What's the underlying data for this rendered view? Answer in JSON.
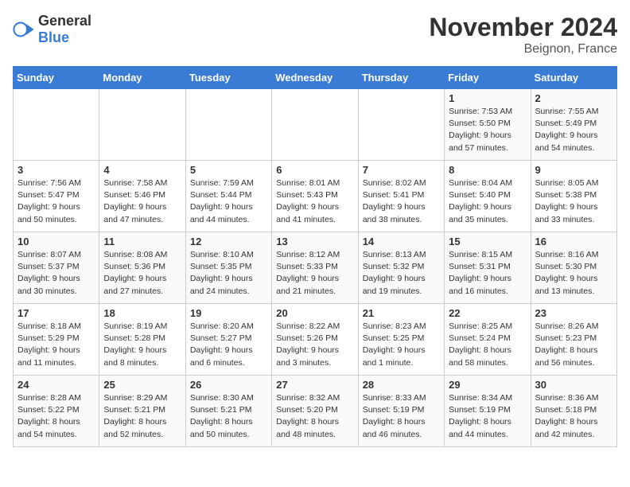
{
  "logo": {
    "text_general": "General",
    "text_blue": "Blue"
  },
  "title": "November 2024",
  "location": "Beignon, France",
  "days_of_week": [
    "Sunday",
    "Monday",
    "Tuesday",
    "Wednesday",
    "Thursday",
    "Friday",
    "Saturday"
  ],
  "weeks": [
    [
      {
        "day": "",
        "info": ""
      },
      {
        "day": "",
        "info": ""
      },
      {
        "day": "",
        "info": ""
      },
      {
        "day": "",
        "info": ""
      },
      {
        "day": "",
        "info": ""
      },
      {
        "day": "1",
        "info": "Sunrise: 7:53 AM\nSunset: 5:50 PM\nDaylight: 9 hours and 57 minutes."
      },
      {
        "day": "2",
        "info": "Sunrise: 7:55 AM\nSunset: 5:49 PM\nDaylight: 9 hours and 54 minutes."
      }
    ],
    [
      {
        "day": "3",
        "info": "Sunrise: 7:56 AM\nSunset: 5:47 PM\nDaylight: 9 hours and 50 minutes."
      },
      {
        "day": "4",
        "info": "Sunrise: 7:58 AM\nSunset: 5:46 PM\nDaylight: 9 hours and 47 minutes."
      },
      {
        "day": "5",
        "info": "Sunrise: 7:59 AM\nSunset: 5:44 PM\nDaylight: 9 hours and 44 minutes."
      },
      {
        "day": "6",
        "info": "Sunrise: 8:01 AM\nSunset: 5:43 PM\nDaylight: 9 hours and 41 minutes."
      },
      {
        "day": "7",
        "info": "Sunrise: 8:02 AM\nSunset: 5:41 PM\nDaylight: 9 hours and 38 minutes."
      },
      {
        "day": "8",
        "info": "Sunrise: 8:04 AM\nSunset: 5:40 PM\nDaylight: 9 hours and 35 minutes."
      },
      {
        "day": "9",
        "info": "Sunrise: 8:05 AM\nSunset: 5:38 PM\nDaylight: 9 hours and 33 minutes."
      }
    ],
    [
      {
        "day": "10",
        "info": "Sunrise: 8:07 AM\nSunset: 5:37 PM\nDaylight: 9 hours and 30 minutes."
      },
      {
        "day": "11",
        "info": "Sunrise: 8:08 AM\nSunset: 5:36 PM\nDaylight: 9 hours and 27 minutes."
      },
      {
        "day": "12",
        "info": "Sunrise: 8:10 AM\nSunset: 5:35 PM\nDaylight: 9 hours and 24 minutes."
      },
      {
        "day": "13",
        "info": "Sunrise: 8:12 AM\nSunset: 5:33 PM\nDaylight: 9 hours and 21 minutes."
      },
      {
        "day": "14",
        "info": "Sunrise: 8:13 AM\nSunset: 5:32 PM\nDaylight: 9 hours and 19 minutes."
      },
      {
        "day": "15",
        "info": "Sunrise: 8:15 AM\nSunset: 5:31 PM\nDaylight: 9 hours and 16 minutes."
      },
      {
        "day": "16",
        "info": "Sunrise: 8:16 AM\nSunset: 5:30 PM\nDaylight: 9 hours and 13 minutes."
      }
    ],
    [
      {
        "day": "17",
        "info": "Sunrise: 8:18 AM\nSunset: 5:29 PM\nDaylight: 9 hours and 11 minutes."
      },
      {
        "day": "18",
        "info": "Sunrise: 8:19 AM\nSunset: 5:28 PM\nDaylight: 9 hours and 8 minutes."
      },
      {
        "day": "19",
        "info": "Sunrise: 8:20 AM\nSunset: 5:27 PM\nDaylight: 9 hours and 6 minutes."
      },
      {
        "day": "20",
        "info": "Sunrise: 8:22 AM\nSunset: 5:26 PM\nDaylight: 9 hours and 3 minutes."
      },
      {
        "day": "21",
        "info": "Sunrise: 8:23 AM\nSunset: 5:25 PM\nDaylight: 9 hours and 1 minute."
      },
      {
        "day": "22",
        "info": "Sunrise: 8:25 AM\nSunset: 5:24 PM\nDaylight: 8 hours and 58 minutes."
      },
      {
        "day": "23",
        "info": "Sunrise: 8:26 AM\nSunset: 5:23 PM\nDaylight: 8 hours and 56 minutes."
      }
    ],
    [
      {
        "day": "24",
        "info": "Sunrise: 8:28 AM\nSunset: 5:22 PM\nDaylight: 8 hours and 54 minutes."
      },
      {
        "day": "25",
        "info": "Sunrise: 8:29 AM\nSunset: 5:21 PM\nDaylight: 8 hours and 52 minutes."
      },
      {
        "day": "26",
        "info": "Sunrise: 8:30 AM\nSunset: 5:21 PM\nDaylight: 8 hours and 50 minutes."
      },
      {
        "day": "27",
        "info": "Sunrise: 8:32 AM\nSunset: 5:20 PM\nDaylight: 8 hours and 48 minutes."
      },
      {
        "day": "28",
        "info": "Sunrise: 8:33 AM\nSunset: 5:19 PM\nDaylight: 8 hours and 46 minutes."
      },
      {
        "day": "29",
        "info": "Sunrise: 8:34 AM\nSunset: 5:19 PM\nDaylight: 8 hours and 44 minutes."
      },
      {
        "day": "30",
        "info": "Sunrise: 8:36 AM\nSunset: 5:18 PM\nDaylight: 8 hours and 42 minutes."
      }
    ]
  ]
}
